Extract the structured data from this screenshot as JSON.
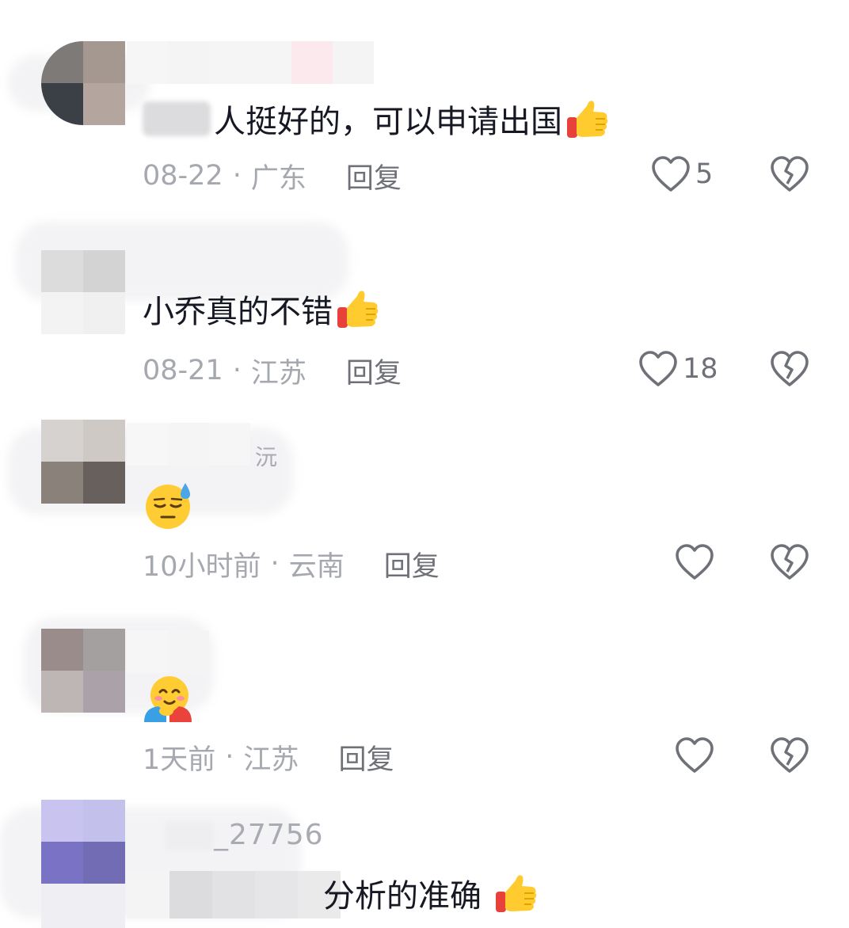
{
  "comments": [
    {
      "text_partial": "人挺好的，可以申请出国",
      "emoji": "thumbs-up",
      "date": "08-22",
      "location": "广东",
      "reply_label": "回复",
      "like_count": "5"
    },
    {
      "text": "小乔真的不错",
      "emoji": "thumbs-up",
      "date": "08-21",
      "location": "江苏",
      "reply_label": "回复",
      "like_count": "18"
    },
    {
      "username_partial": "沅",
      "emoji": "downcast-sweat-face",
      "date": "10小时前",
      "location": "云南",
      "reply_label": "回复",
      "like_count": ""
    },
    {
      "emoji": "hugging-face",
      "date": "1天前",
      "location": "江苏",
      "reply_label": "回复",
      "like_count": ""
    },
    {
      "username_partial": "_27756",
      "text_partial": "分析的准确",
      "emoji": "thumbs-up"
    }
  ],
  "separator": "·",
  "icons": {
    "like": "heart-outline-icon",
    "dislike": "broken-heart-icon"
  },
  "colors": {
    "text_primary": "#161823",
    "text_secondary": "#a6a8af",
    "reply": "#6f7178",
    "icon": "#6f7178"
  }
}
